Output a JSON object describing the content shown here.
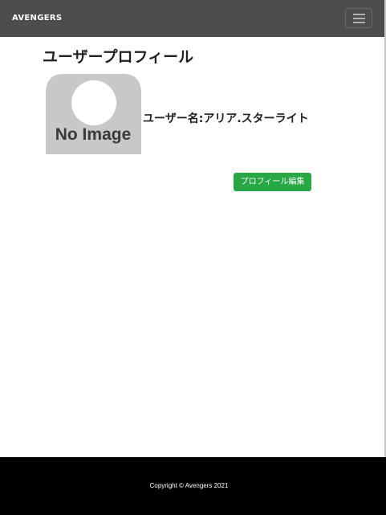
{
  "navbar": {
    "brand": "AVENGERS",
    "toggler_icon": "hamburger-menu-icon",
    "background": "#4d4d4d"
  },
  "main": {
    "title": "ユーザープロフィール",
    "avatar": {
      "text": "No Image",
      "icon": "user-silhouette-icon",
      "color": "#c8c8c8"
    },
    "username": "ユーザー名:アリア.スターライト",
    "edit_button_label": "プロフィール編集",
    "edit_button_color": "#28a745"
  },
  "footer": {
    "copyright": "Copyright © Avengers 2021",
    "background": "#000000"
  }
}
